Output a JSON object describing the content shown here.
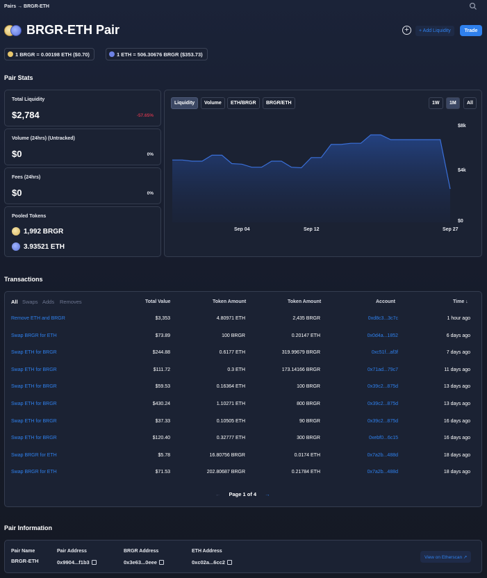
{
  "breadcrumb": "Pairs → BRGR-ETH",
  "pair": {
    "title": "BRGR-ETH Pair"
  },
  "header": {
    "add_liquidity": "+ Add Liquidity",
    "trade": "Trade"
  },
  "rates": {
    "brgr_eth": "1 BRGR = 0.00198 ETH ($0.70)",
    "eth_brgr": "1 ETH = 506.30676 BRGR ($353.73)"
  },
  "pair_stats": {
    "title": "Pair Stats",
    "total_liquidity": {
      "label": "Total Liquidity",
      "value": "$2,784",
      "change": "-57.65%"
    },
    "volume": {
      "label": "Volume (24hrs) (Untracked)",
      "value": "$0",
      "change": "0%"
    },
    "fees": {
      "label": "Fees (24hrs)",
      "value": "$0",
      "change": "0%"
    },
    "pooled": {
      "label": "Pooled Tokens",
      "brgr": "1,992 BRGR",
      "eth": "3.93521 ETH"
    }
  },
  "chart_tabs": [
    "Liquidity",
    "Volume",
    "ETH/BRGR",
    "BRGR/ETH"
  ],
  "range_tabs": [
    "1W",
    "1M",
    "All"
  ],
  "chart_data": {
    "type": "area",
    "title": "",
    "series": [
      {
        "values": [
          5200,
          5200,
          5100,
          5100,
          5600,
          5600,
          4900,
          4850,
          4600,
          4600,
          5100,
          5100,
          4600,
          4550,
          5400,
          5400,
          6500,
          6500,
          6600,
          6600,
          7300,
          7300,
          6900,
          6900,
          6900,
          6900,
          6900,
          6900,
          2784
        ]
      }
    ],
    "x_ticks": [
      "Sep 04",
      "Sep 12",
      "Sep 27"
    ],
    "y_ticks": [
      "$8k",
      "$4k",
      "$0"
    ],
    "ylim": [
      0,
      8000
    ],
    "color": "#3a6fd8",
    "grid": false
  },
  "transactions": {
    "title": "Transactions",
    "filters": [
      "All",
      "Swaps",
      "Adds",
      "Removes"
    ],
    "headers": [
      "Total Value",
      "Token Amount",
      "Token Amount",
      "Account",
      "Time ↓"
    ],
    "rows": [
      [
        "Remove ETH and BRGR",
        "$3,353",
        "4.80971 ETH",
        "2,435 BRGR",
        "0xd8c3...3c7c",
        "1 hour ago"
      ],
      [
        "Swap BRGR for ETH",
        "$73.89",
        "100 BRGR",
        "0.20147 ETH",
        "0x0d4a...1852",
        "6 days ago"
      ],
      [
        "Swap ETH for BRGR",
        "$244.88",
        "0.6177 ETH",
        "319.99679 BRGR",
        "0xc51f...af3f",
        "7 days ago"
      ],
      [
        "Swap ETH for BRGR",
        "$111.72",
        "0.3 ETH",
        "173.14166 BRGR",
        "0x71ad...79c7",
        "11 days ago"
      ],
      [
        "Swap ETH for BRGR",
        "$59.53",
        "0.16364 ETH",
        "100 BRGR",
        "0x39c2...875d",
        "13 days ago"
      ],
      [
        "Swap ETH for BRGR",
        "$430.24",
        "1.10271 ETH",
        "800 BRGR",
        "0x39c2...875d",
        "13 days ago"
      ],
      [
        "Swap ETH for BRGR",
        "$37.33",
        "0.10505 ETH",
        "90 BRGR",
        "0x39c2...875d",
        "16 days ago"
      ],
      [
        "Swap ETH for BRGR",
        "$120.40",
        "0.32777 ETH",
        "300 BRGR",
        "0xebf0...6c15",
        "16 days ago"
      ],
      [
        "Swap BRGR for ETH",
        "$5.78",
        "16.80756 BRGR",
        "0.0174 ETH",
        "0x7a2b...488d",
        "18 days ago"
      ],
      [
        "Swap BRGR for ETH",
        "$71.53",
        "202.80687 BRGR",
        "0.21784 ETH",
        "0x7a2b...488d",
        "18 days ago"
      ]
    ],
    "pager": {
      "prev": "←",
      "label": "Page 1 of 4",
      "next": "→"
    }
  },
  "pair_info": {
    "title": "Pair Information",
    "pair_name_label": "Pair Name",
    "pair_name": "BRGR-ETH",
    "pair_address_label": "Pair Address",
    "pair_address": "0x9904...f1b3",
    "brgr_address_label": "BRGR Address",
    "brgr_address": "0x3e63...0eee",
    "eth_address_label": "ETH Address",
    "eth_address": "0xc02a...6cc2",
    "etherscan": "View on Etherscan ↗"
  }
}
